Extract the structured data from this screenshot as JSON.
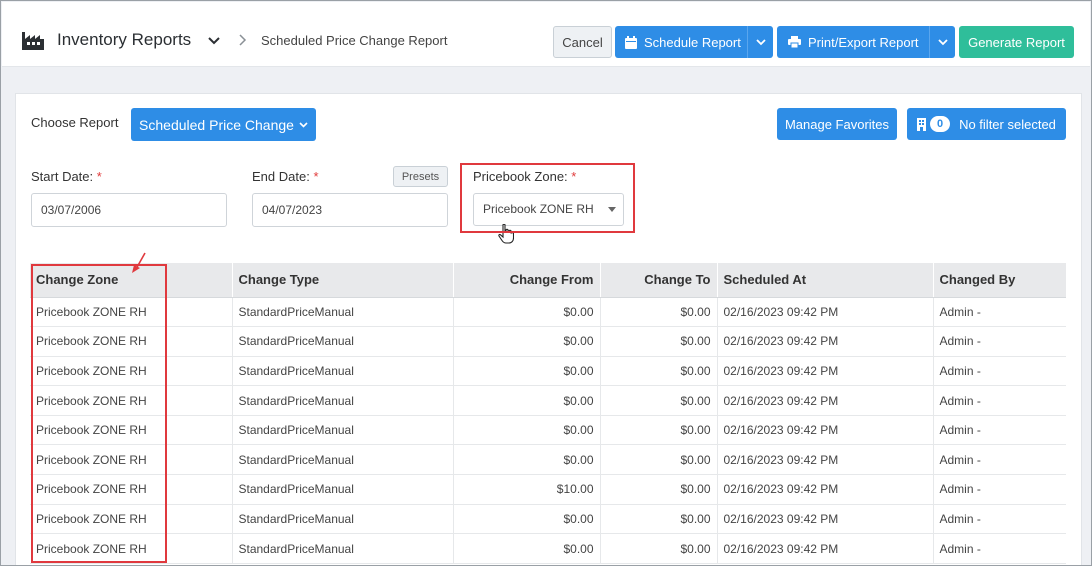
{
  "header": {
    "app_title": "Inventory Reports",
    "breadcrumb": "Scheduled Price Change Report",
    "cancel_label": "Cancel",
    "schedule_label": "Schedule Report",
    "print_label": "Print/Export Report",
    "generate_label": "Generate Report"
  },
  "report": {
    "choose_label": "Choose Report",
    "selected_report": "Scheduled Price Change",
    "manage_favorites_label": "Manage Favorites",
    "filter_count": "0",
    "filter_label": "No filter selected"
  },
  "filters": {
    "start_date_label": "Start Date:",
    "start_date_value": "03/07/2006",
    "end_date_label": "End Date:",
    "end_date_value": "04/07/2023",
    "required_mark": "*",
    "presets_label": "Presets",
    "zone_label": "Pricebook Zone:",
    "zone_value": "Pricebook ZONE RH"
  },
  "table": {
    "columns": [
      "Change Zone",
      "Change Type",
      "Change From",
      "Change To",
      "Scheduled At",
      "Changed By"
    ],
    "rows": [
      [
        "Pricebook ZONE RH",
        "StandardPriceManual",
        "$0.00",
        "$0.00",
        "02/16/2023 09:42 PM",
        "Admin -"
      ],
      [
        "Pricebook ZONE RH",
        "StandardPriceManual",
        "$0.00",
        "$0.00",
        "02/16/2023 09:42 PM",
        "Admin -"
      ],
      [
        "Pricebook ZONE RH",
        "StandardPriceManual",
        "$0.00",
        "$0.00",
        "02/16/2023 09:42 PM",
        "Admin -"
      ],
      [
        "Pricebook ZONE RH",
        "StandardPriceManual",
        "$0.00",
        "$0.00",
        "02/16/2023 09:42 PM",
        "Admin -"
      ],
      [
        "Pricebook ZONE RH",
        "StandardPriceManual",
        "$0.00",
        "$0.00",
        "02/16/2023 09:42 PM",
        "Admin -"
      ],
      [
        "Pricebook ZONE RH",
        "StandardPriceManual",
        "$0.00",
        "$0.00",
        "02/16/2023 09:42 PM",
        "Admin -"
      ],
      [
        "Pricebook ZONE RH",
        "StandardPriceManual",
        "$10.00",
        "$0.00",
        "02/16/2023 09:42 PM",
        "Admin -"
      ],
      [
        "Pricebook ZONE RH",
        "StandardPriceManual",
        "$0.00",
        "$0.00",
        "02/16/2023 09:42 PM",
        "Admin -"
      ],
      [
        "Pricebook ZONE RH",
        "StandardPriceManual",
        "$0.00",
        "$0.00",
        "02/16/2023 09:42 PM",
        "Admin -"
      ]
    ]
  },
  "colors": {
    "primary_blue": "#2e8de6",
    "generate_green": "#2fbe9a",
    "highlight_red": "#e0393e",
    "table_header_bg": "#e8e9eb"
  },
  "icons": [
    "factory-icon",
    "chevron-down-icon",
    "chevron-right-icon",
    "calendar-icon",
    "printer-icon",
    "building-icon",
    "pointer-cursor-icon"
  ]
}
